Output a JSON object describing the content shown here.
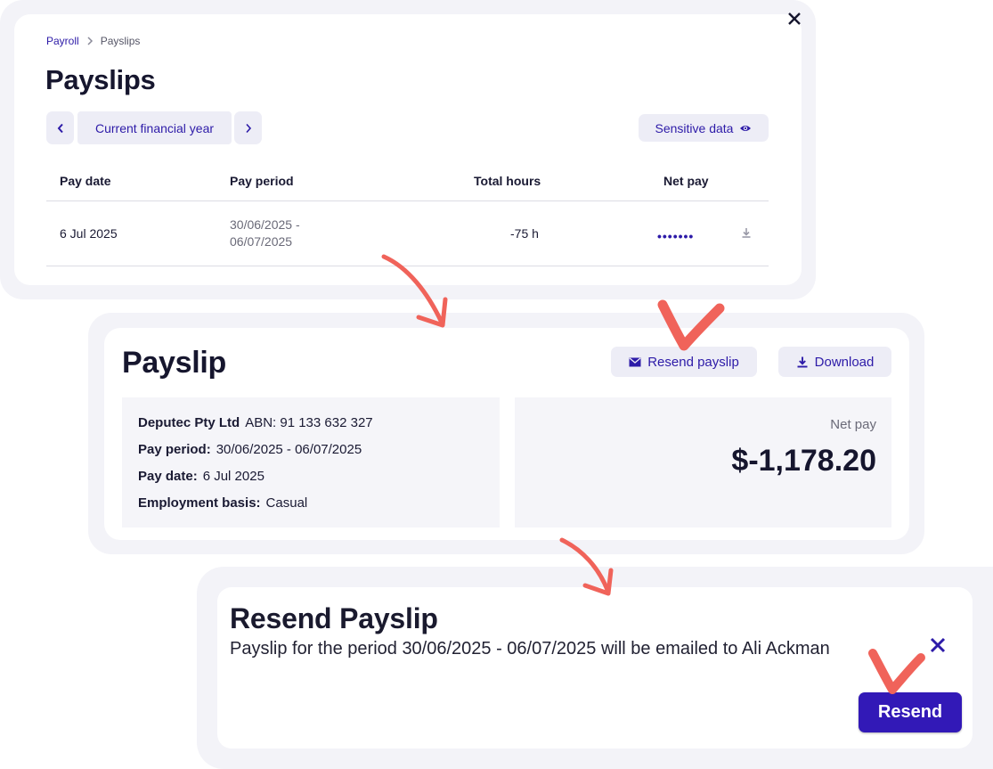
{
  "colors": {
    "accent": "#2d1ba8",
    "primary_button": "#3219b7",
    "annotation": "#f0635a",
    "frame_bg": "#f3f3f8",
    "button_bg": "#ededf6"
  },
  "payslips_panel": {
    "breadcrumb": {
      "parent": "Payroll",
      "current": "Payslips"
    },
    "title": "Payslips",
    "period_selector": {
      "label": "Current financial year"
    },
    "sensitive_data_label": "Sensitive data",
    "table": {
      "headers": [
        "Pay date",
        "Pay period",
        "Total hours",
        "Net pay"
      ],
      "rows": [
        {
          "pay_date": "6 Jul 2025",
          "pay_period_start": "30/06/2025 -",
          "pay_period_end": "06/07/2025",
          "total_hours": "-75 h",
          "net_pay_masked": "•••••••"
        }
      ]
    }
  },
  "payslip_panel": {
    "title": "Payslip",
    "resend_label": "Resend payslip",
    "download_label": "Download",
    "company": "Deputec Pty Ltd",
    "abn": "ABN: 91 133 632 327",
    "pay_period_label": "Pay period:",
    "pay_period_value": "30/06/2025 - 06/07/2025",
    "pay_date_label": "Pay date:",
    "pay_date_value": "6 Jul 2025",
    "employment_basis_label": "Employment basis:",
    "employment_basis_value": "Casual",
    "net_pay_label": "Net pay",
    "net_pay_value": "$-1,178.20"
  },
  "resend_dialog": {
    "title": "Resend Payslip",
    "message": "Payslip for the period 30/06/2025 - 06/07/2025 will be emailed to Ali Ackman",
    "resend_button": "Resend"
  },
  "icons": {
    "close": "close-icon",
    "chevron_left": "chevron-left-icon",
    "chevron_right": "chevron-right-icon",
    "eye": "eye-icon",
    "download": "download-icon",
    "mail": "mail-icon",
    "annotation_arrow": "arrow-annotation-icon",
    "annotation_check": "checkmark-annotation-icon"
  }
}
